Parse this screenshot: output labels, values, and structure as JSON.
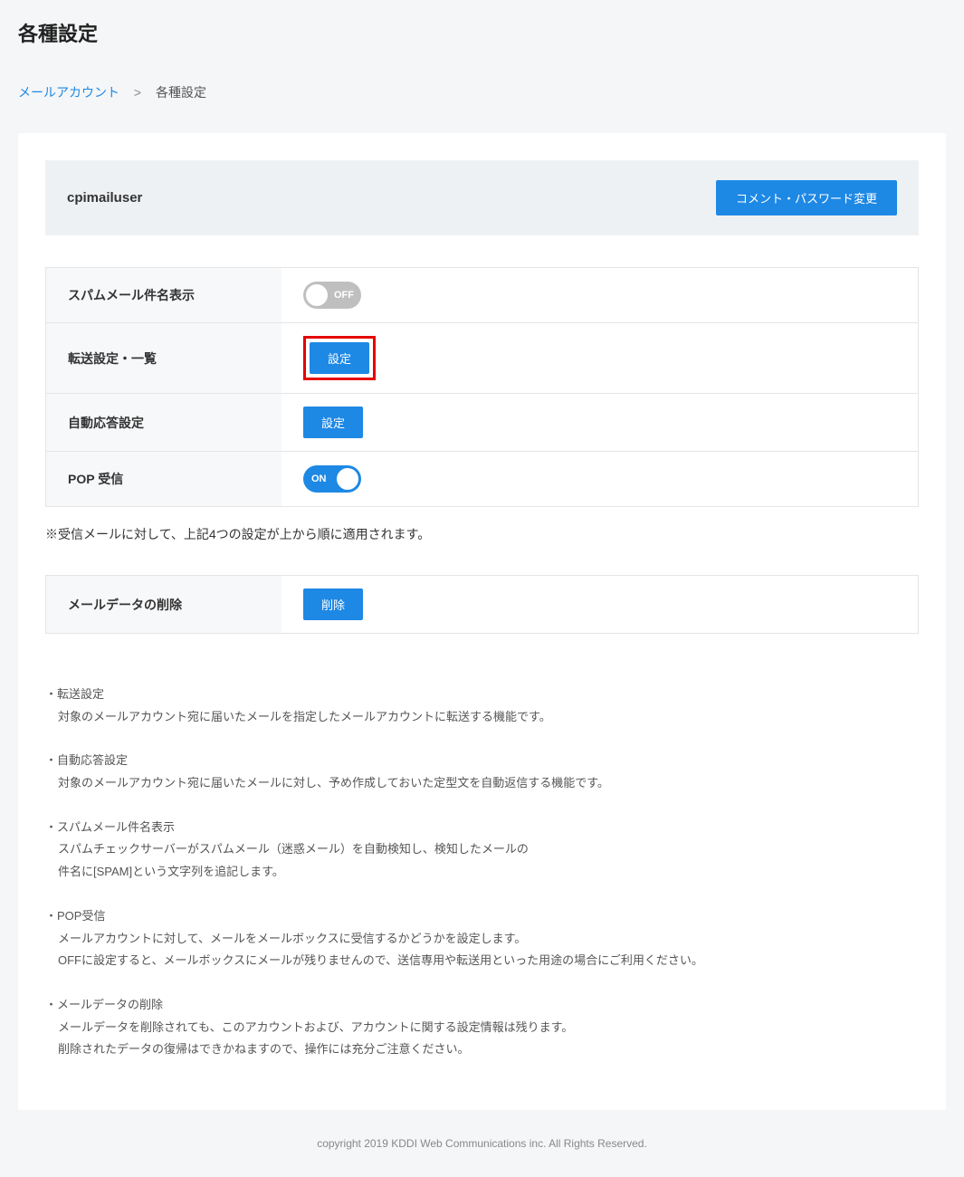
{
  "page": {
    "title": "各種設定"
  },
  "breadcrumb": {
    "parent": "メールアカウント",
    "separator": ">",
    "current": "各種設定"
  },
  "account": {
    "name": "cpimailuser",
    "change_button": "コメント・パスワード変更"
  },
  "settings": {
    "spam_subject": {
      "label": "スパムメール件名表示",
      "toggle": "OFF"
    },
    "forward": {
      "label": "転送設定・一覧",
      "button": "設定"
    },
    "autoreply": {
      "label": "自動応答設定",
      "button": "設定"
    },
    "pop": {
      "label": "POP 受信",
      "toggle": "ON"
    }
  },
  "note": "※受信メールに対して、上記4つの設定が上から順に適用されます。",
  "delete": {
    "label": "メールデータの削除",
    "button": "削除"
  },
  "descriptions": {
    "forward": {
      "title": "・転送設定",
      "body": "対象のメールアカウント宛に届いたメールを指定したメールアカウントに転送する機能です。"
    },
    "autoreply": {
      "title": "・自動応答設定",
      "body": "対象のメールアカウント宛に届いたメールに対し、予め作成しておいた定型文を自動返信する機能です。"
    },
    "spam": {
      "title": "・スパムメール件名表示",
      "body1": "スパムチェックサーバーがスパムメール（迷惑メール）を自動検知し、検知したメールの",
      "body2": "件名に[SPAM]という文字列を追記します。"
    },
    "pop": {
      "title": "・POP受信",
      "body1": "メールアカウントに対して、メールをメールボックスに受信するかどうかを設定します。",
      "body2": "OFFに設定すると、メールボックスにメールが残りませんので、送信専用や転送用といった用途の場合にご利用ください。"
    },
    "delete": {
      "title": "・メールデータの削除",
      "body1": "メールデータを削除されても、このアカウントおよび、アカウントに関する設定情報は残ります。",
      "body2": "削除されたデータの復帰はできかねますので、操作には充分ご注意ください。"
    }
  },
  "footer": "copyright 2019 KDDI Web Communications inc. All Rights Reserved."
}
